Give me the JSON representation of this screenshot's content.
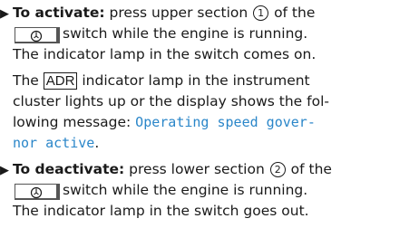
{
  "bullet_glyph": "▶",
  "step1": {
    "label": "To activate:",
    "text_a": " press upper section ",
    "num": "1",
    "text_b": " of the",
    "text_c": "switch while the engine is running.",
    "line3": "The indicator lamp in the switch comes on."
  },
  "para": {
    "line1_a": "The ",
    "adr": "ADR",
    "line1_b": " indicator lamp in the instrument",
    "line2": "cluster lights up or the display shows the fol-",
    "line3_a": "lowing message: ",
    "message_part1": "Operating speed gover-",
    "message_part2": "nor active",
    "line4_end": "."
  },
  "step2": {
    "label": "To deactivate:",
    "text_a": " press lower section ",
    "num": "2",
    "text_b": " of the",
    "text_c": "switch while the engine is running.",
    "line3": "The indicator lamp in the switch goes out."
  },
  "colors": {
    "message": "#2a86c9",
    "text": "#1a1a1a"
  },
  "icons": {
    "switch_symbol": "speed-governor-switch-icon"
  }
}
